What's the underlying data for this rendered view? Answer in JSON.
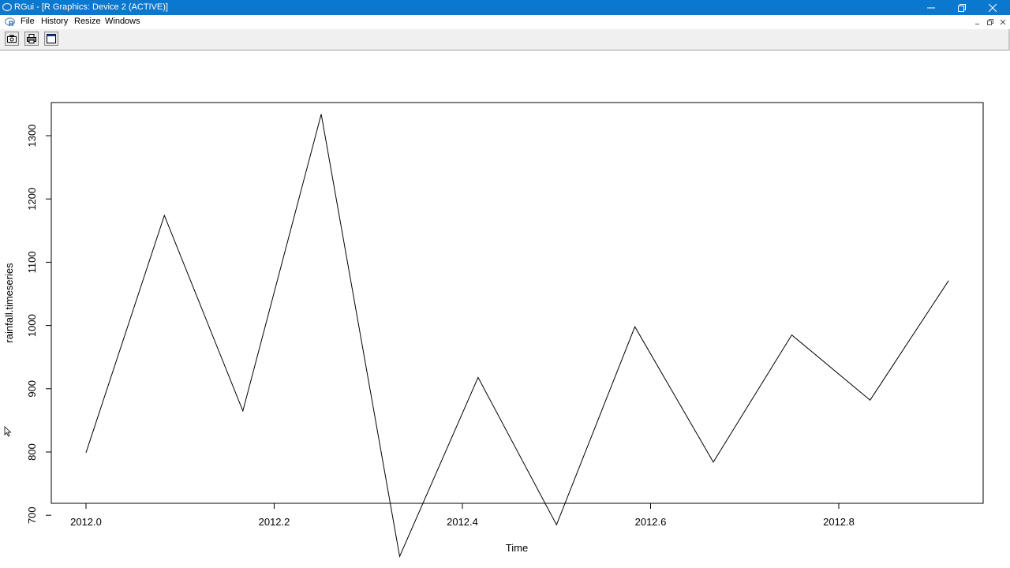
{
  "window": {
    "title": "RGui - [R Graphics: Device 2 (ACTIVE)]",
    "icons": [
      "r-logo-icon",
      "minimize-icon",
      "restore-icon",
      "close-icon"
    ]
  },
  "menubar": {
    "items": [
      {
        "label": "File"
      },
      {
        "label": "History"
      },
      {
        "label": "Resize"
      },
      {
        "label": "Windows"
      }
    ]
  },
  "toolbar": {
    "buttons": [
      {
        "icon": "copy-metafile-icon"
      },
      {
        "icon": "print-icon"
      },
      {
        "icon": "window-icon"
      }
    ]
  },
  "chart_data": {
    "type": "line",
    "x": [
      2012.0,
      2012.0833,
      2012.1667,
      2012.25,
      2012.3333,
      2012.4167,
      2012.5,
      2012.5833,
      2012.6667,
      2012.75,
      2012.8333,
      2012.9167
    ],
    "values": [
      799,
      1174,
      865,
      1334,
      635,
      918,
      685,
      998,
      784,
      985,
      882,
      1071
    ],
    "xlabel": "Time",
    "ylabel": "rainfall.timeseries",
    "xlim": [
      1911.923,
      2012.994
    ],
    "ylim": [
      623.6,
      1352.2
    ],
    "xticks": [
      "2012.0",
      "2012.2",
      "2012.4",
      "2012.6",
      "2012.8"
    ],
    "xtick_values": [
      2012.0,
      2012.2,
      2012.4,
      2012.6,
      2012.8
    ],
    "yticks": [
      "700",
      "800",
      "900",
      "1000",
      "1100",
      "1200",
      "1300"
    ],
    "ytick_values": [
      700,
      800,
      900,
      1000,
      1100,
      1200,
      1300
    ],
    "line_color": "#000000",
    "grid": false
  },
  "colors": {
    "titlebar": "#0b78d0",
    "toolbar": "#f0f0f0"
  }
}
